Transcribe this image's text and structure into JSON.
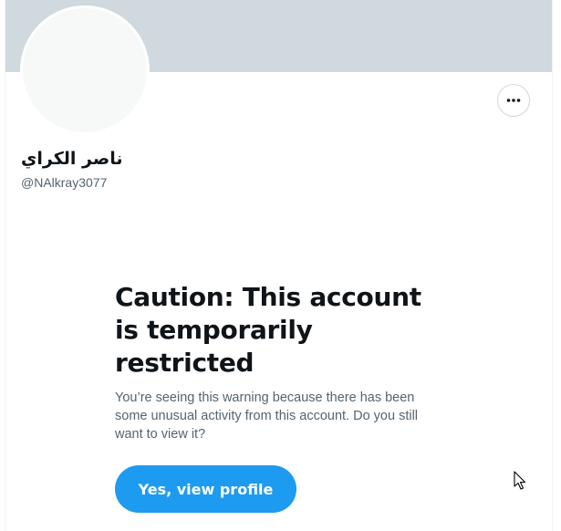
{
  "profile": {
    "display_name": "ناصر الكراي",
    "handle": "@NAlkray3077"
  },
  "actions": {
    "more_icon": "more-horizontal-icon"
  },
  "warning": {
    "title": "Caution: This account is temporarily restricted",
    "body": "You’re seeing this warning because there has been some unusual activity from this account. Do you still want to view it?",
    "button_label": "Yes, view profile"
  },
  "colors": {
    "banner": "#cfd9de",
    "avatar": "#f7f9f9",
    "accent": "#1d9bf0",
    "primary_text": "#0f1419",
    "secondary_text": "#536471"
  }
}
